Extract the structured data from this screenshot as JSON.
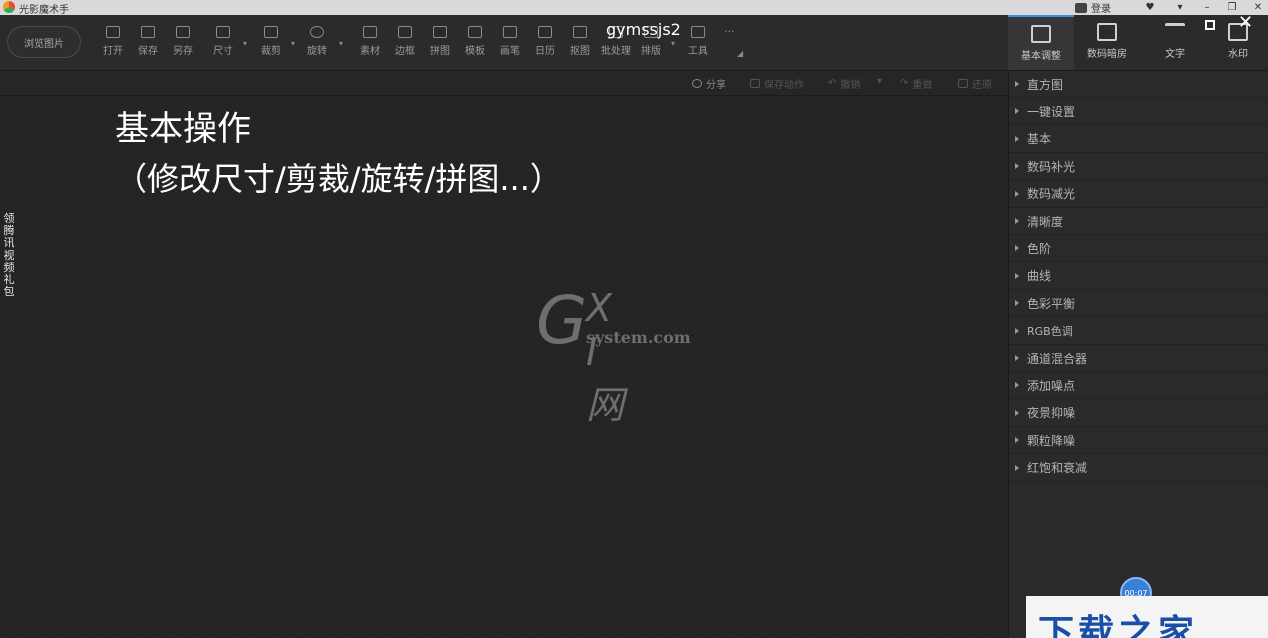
{
  "app": {
    "title": "光影魔术手",
    "login": "登录",
    "overlay_title": "gymssjs2"
  },
  "toolbar": {
    "browse": "浏览图片",
    "tools": [
      {
        "label": "打开",
        "icon": "open-icon"
      },
      {
        "label": "保存",
        "icon": "save-icon"
      },
      {
        "label": "另存",
        "icon": "save-as-icon"
      },
      {
        "label": "尺寸",
        "icon": "resize-icon"
      },
      {
        "label": "裁剪",
        "icon": "crop-icon"
      },
      {
        "label": "旋转",
        "icon": "rotate-icon"
      },
      {
        "label": "素材",
        "icon": "material-icon"
      },
      {
        "label": "边框",
        "icon": "frame-icon"
      },
      {
        "label": "拼图",
        "icon": "collage-icon"
      },
      {
        "label": "模板",
        "icon": "template-icon"
      },
      {
        "label": "画笔",
        "icon": "brush-icon"
      },
      {
        "label": "日历",
        "icon": "calendar-icon"
      },
      {
        "label": "抠图",
        "icon": "cutout-icon"
      },
      {
        "label": "批处理",
        "icon": "batch-icon"
      },
      {
        "label": "排版",
        "icon": "layout-icon"
      },
      {
        "label": "工具",
        "icon": "wrench-icon"
      }
    ],
    "more": "···"
  },
  "right_tabs": [
    {
      "label": "基本调整",
      "icon": "adjust-icon"
    },
    {
      "label": "数码暗房",
      "icon": "camera-icon"
    },
    {
      "label": "文字",
      "icon": "text-icon"
    },
    {
      "label": "水印",
      "icon": "watermark-icon"
    }
  ],
  "actions": {
    "share": "分享",
    "save_action": "保存动作",
    "undo": "撤销",
    "redo": "重做",
    "restore": "还原"
  },
  "canvas": {
    "heading": "基本操作",
    "subheading": "（修改尺寸/剪裁/旋转/拼图...）",
    "watermark_g": "G",
    "watermark_xi": "X I 网",
    "watermark_sub": "system.com",
    "side_text": "领\n腾\n讯\n视\n频\n礼\n包"
  },
  "adjust_items": [
    "直方图",
    "一键设置",
    "基本",
    "数码补光",
    "数码减光",
    "清晰度",
    "色阶",
    "曲线",
    "色彩平衡",
    "RGB色调",
    "通道混合器",
    "添加噪点",
    "夜景抑噪",
    "颗粒降噪",
    "红饱和衰减"
  ],
  "timer": "00:07",
  "banner": "下载之家"
}
